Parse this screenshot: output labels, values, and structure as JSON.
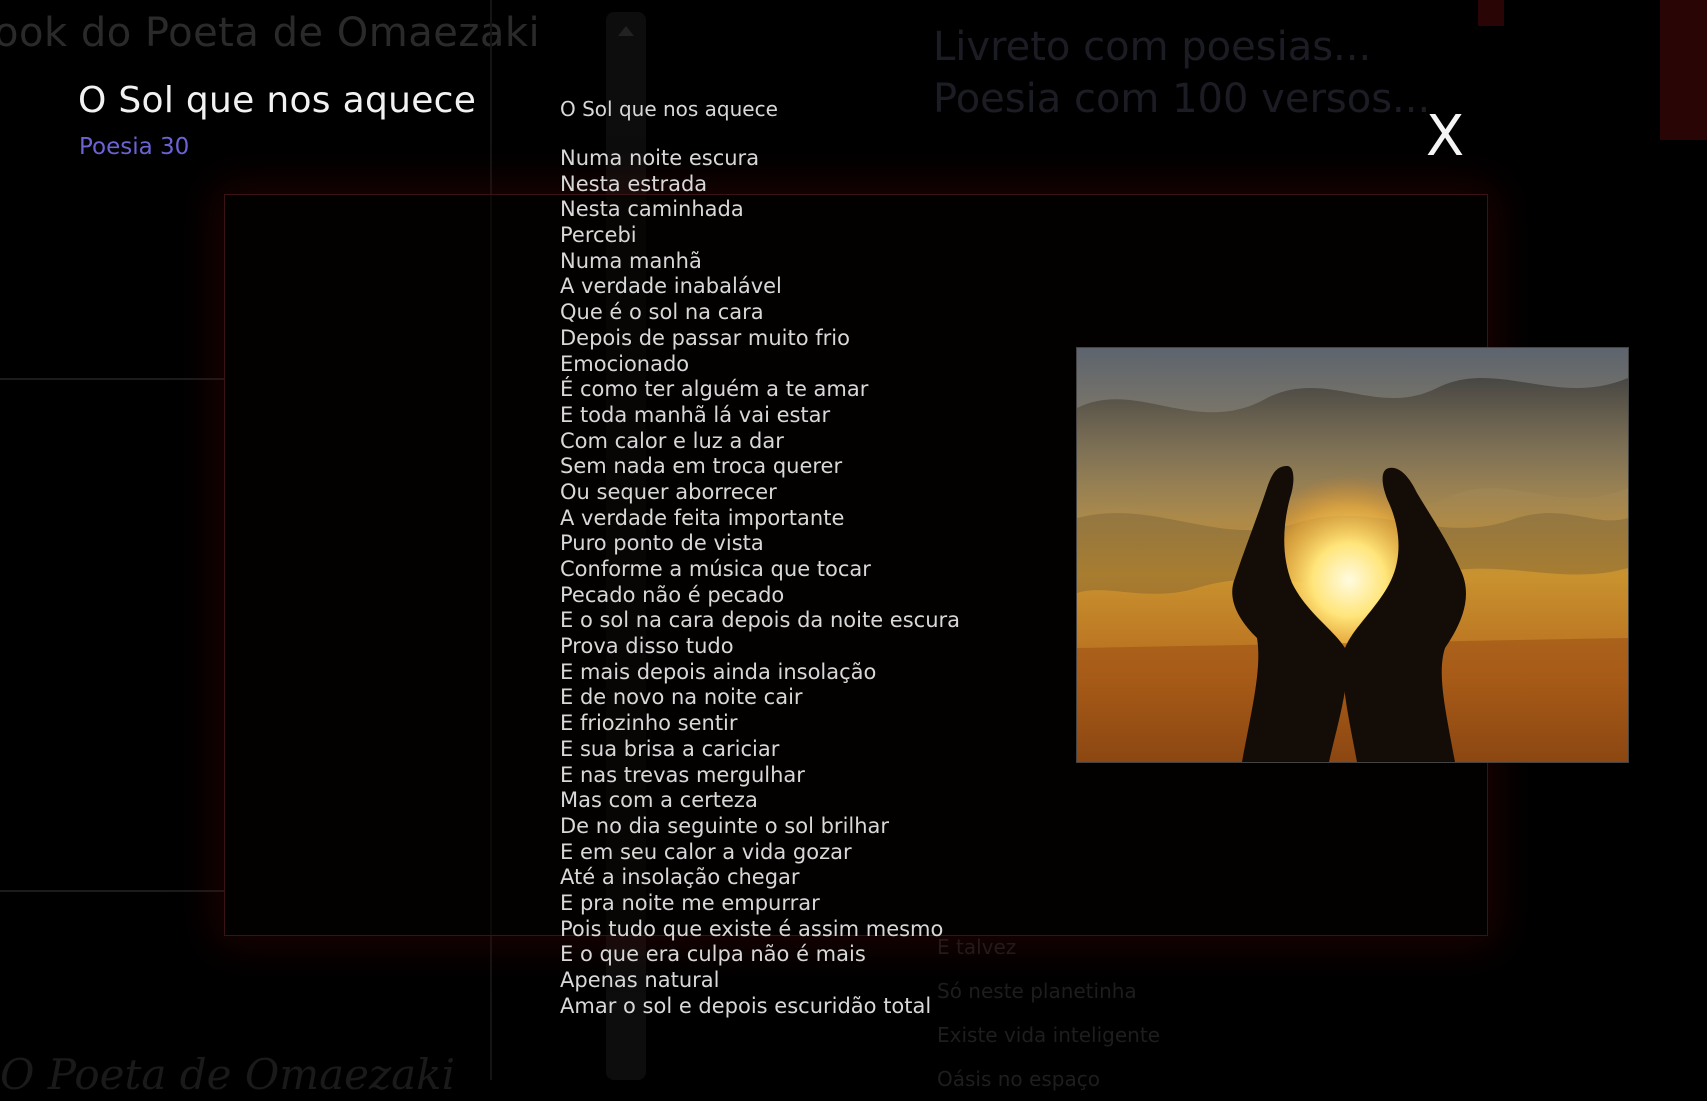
{
  "background": {
    "site_title": "ook do Poeta de Omaezaki",
    "right_titles": [
      "Livreto com poesias...",
      "Poesia com 100 versos..."
    ],
    "right_list": [
      "E talvez",
      "Só neste planetinha",
      "Existe vida inteligente",
      "Oásis no espaço"
    ],
    "bottom_title": "O Poeta de Omaezaki"
  },
  "overlay": {
    "heading": "O Sol que nos aquece",
    "subtitle": "Poesia 30",
    "close_label": "X",
    "poem": {
      "title": "O Sol que nos aquece",
      "verses": [
        "Numa noite escura",
        "Nesta estrada",
        "Nesta caminhada",
        "Percebi",
        "Numa manhã",
        "A verdade inabalável",
        "Que é o sol na cara",
        "Depois de passar muito frio",
        "Emocionado",
        "É como ter alguém a te amar",
        "E toda manhã lá vai estar",
        "Com calor e luz a dar",
        "Sem nada em troca querer",
        "Ou sequer aborrecer",
        "A verdade feita importante",
        "Puro ponto de vista",
        "Conforme a música que tocar",
        "Pecado não é pecado",
        "E o sol na cara depois da noite escura",
        "Prova disso tudo",
        "E mais depois ainda insolação",
        "E de novo na noite cair",
        "E friozinho sentir",
        "E sua brisa a cariciar",
        "E nas trevas mergulhar",
        "Mas com a certeza",
        "De no dia seguinte o sol brilhar",
        "E em seu calor a vida gozar",
        "Até a insolação chegar",
        "E pra noite me empurrar",
        "Pois tudo que existe é assim mesmo",
        "E o que era culpa não é mais",
        "Apenas natural",
        "Amar o sol e depois escuridão total"
      ]
    },
    "image": {
      "subject": "hands-cupping-sun-at-sunset"
    }
  },
  "colors": {
    "background": "#000000",
    "heading": "#f2f2f2",
    "subtitle_accent": "#6b63d4",
    "verse_text": "#d8d8d8",
    "frame_border": "#3a1414"
  }
}
